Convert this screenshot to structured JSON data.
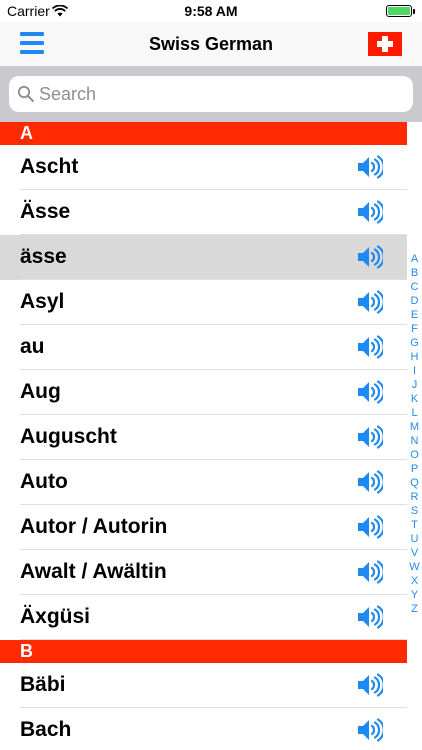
{
  "status": {
    "carrier": "Carrier",
    "time": "9:58 AM"
  },
  "nav": {
    "title": "Swiss German"
  },
  "search": {
    "placeholder": "Search"
  },
  "sections": [
    {
      "letter": "A",
      "items": [
        "Ascht",
        "Ässe",
        "ässe",
        "Asyl",
        "au",
        "Aug",
        "Auguscht",
        "Auto",
        "Autor / Autorin",
        "Awalt / Awältin",
        "Äxgüsi"
      ]
    },
    {
      "letter": "B",
      "items": [
        "Bäbi",
        "Bach"
      ]
    }
  ],
  "selected_item": "ässe",
  "index_letters": [
    "A",
    "B",
    "C",
    "D",
    "E",
    "F",
    "G",
    "H",
    "I",
    "J",
    "K",
    "L",
    "M",
    "N",
    "O",
    "P",
    "Q",
    "R",
    "S",
    "T",
    "U",
    "V",
    "W",
    "X",
    "Y",
    "Z"
  ],
  "colors": {
    "accent": "#1e8af1",
    "section": "#ff2a00",
    "selected_row": "#d9d9d9"
  }
}
